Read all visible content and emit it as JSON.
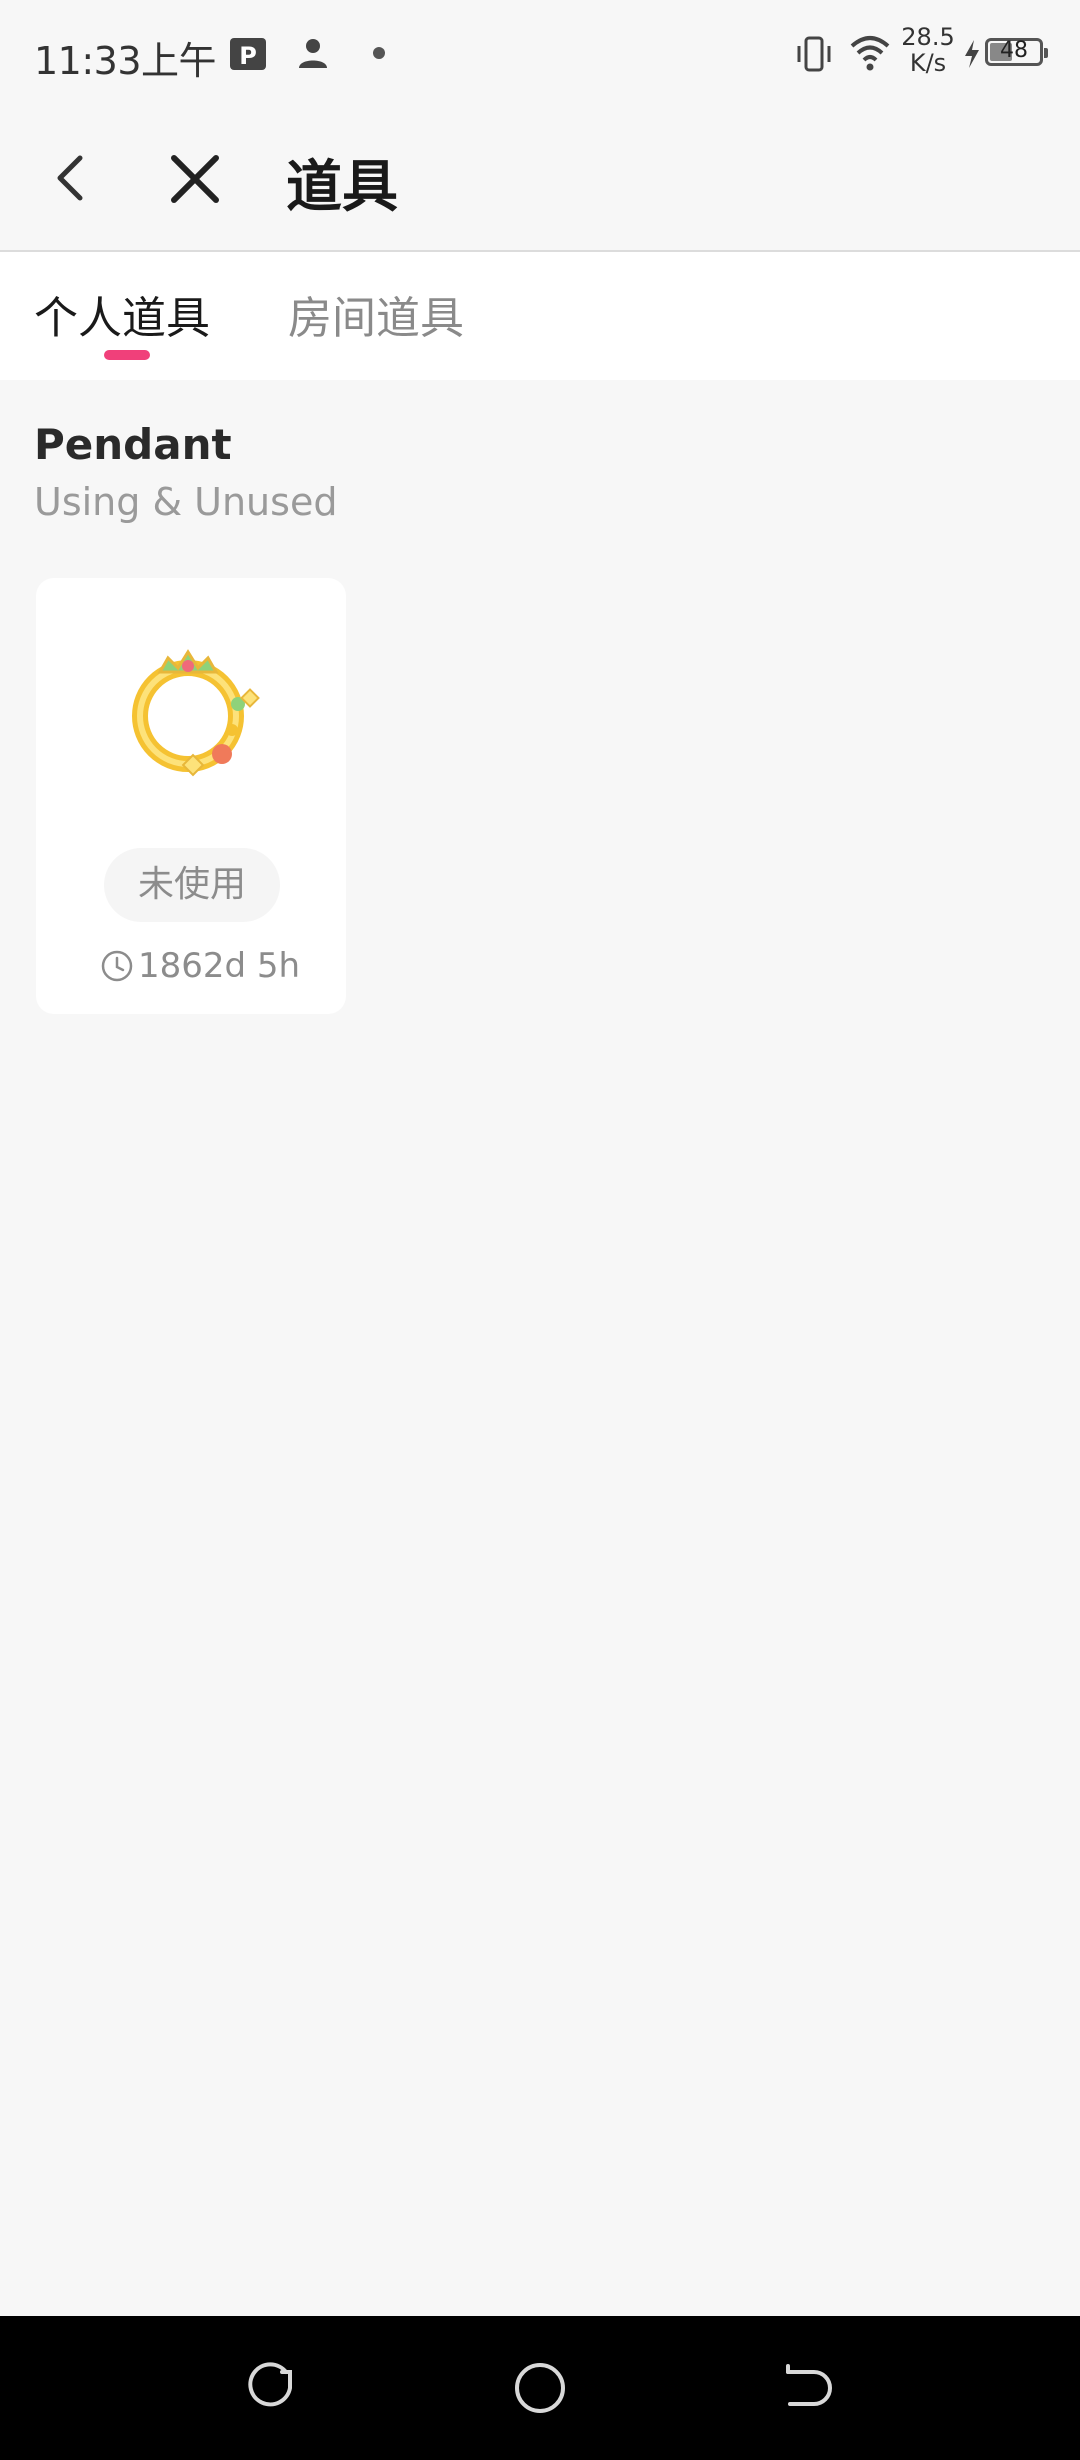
{
  "status_bar": {
    "time": "11:33上午",
    "net_speed_value": "28.5",
    "net_speed_unit": "K/s",
    "battery": "48",
    "battery_level_percent": 48
  },
  "header": {
    "title": "道具"
  },
  "tabs": [
    {
      "label": "个人道具",
      "active": true
    },
    {
      "label": "房间道具",
      "active": false
    }
  ],
  "section": {
    "title": "Pendant",
    "subtitle": "Using & Unused"
  },
  "items": [
    {
      "status": "未使用",
      "time_left": "1862d 5h"
    }
  ],
  "colors": {
    "accent": "#f0407a",
    "background": "#f7f7f7"
  }
}
